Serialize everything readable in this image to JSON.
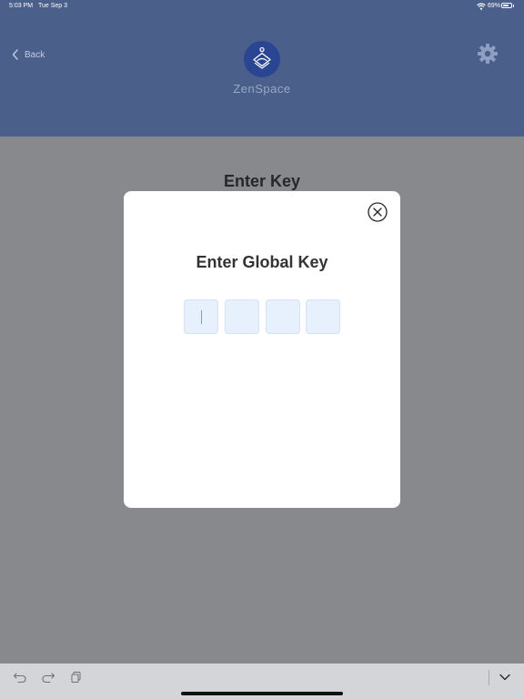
{
  "status_bar": {
    "time": "5:03 PM",
    "date": "Tue Sep 3",
    "battery_percent": "69%",
    "battery_level": 0.69
  },
  "header": {
    "back_label": "Back",
    "app_name": "ZenSpace",
    "background_color": "#4a5f8a",
    "logo_color": "#2a4693"
  },
  "page": {
    "title": "Enter Key"
  },
  "modal": {
    "title": "Enter Global Key",
    "key_boxes": [
      "",
      "",
      "",
      ""
    ],
    "box_color": "#e7f0fd"
  },
  "toolbar": {
    "icons": [
      "undo-icon",
      "redo-icon",
      "paste-icon",
      "chevron-down-icon"
    ]
  }
}
